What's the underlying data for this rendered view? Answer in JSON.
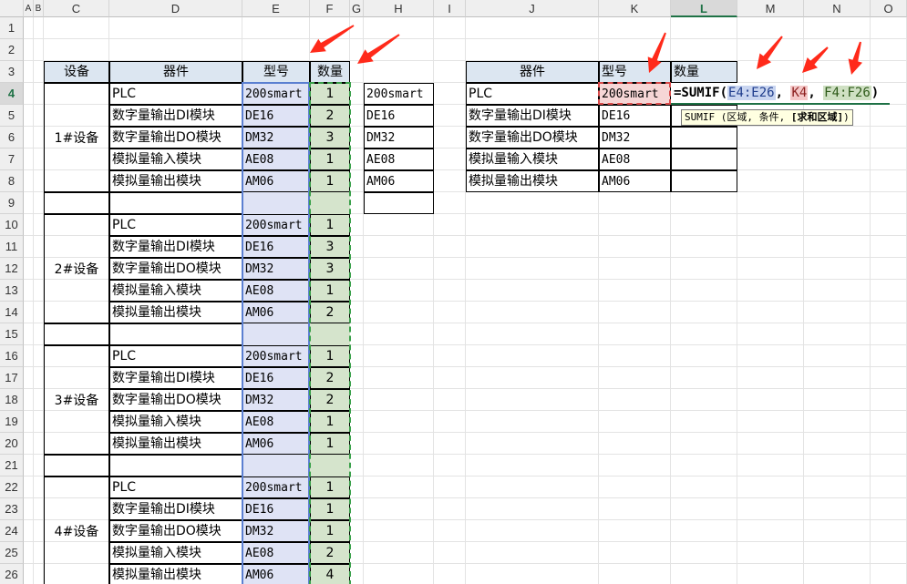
{
  "columns": [
    "A",
    "B",
    "C",
    "D",
    "E",
    "F",
    "G",
    "H",
    "I",
    "J",
    "K",
    "L",
    "M",
    "N",
    "O"
  ],
  "rows": [
    "1",
    "2",
    "3",
    "4",
    "5",
    "6",
    "7",
    "8",
    "9",
    "10",
    "11",
    "12",
    "13",
    "14",
    "15",
    "16",
    "17",
    "18",
    "19",
    "20",
    "21",
    "22",
    "23",
    "24",
    "25",
    "26"
  ],
  "selected_column": "L",
  "selected_row": "4",
  "left_table": {
    "headers": {
      "device": "设备",
      "component": "器件",
      "model": "型号",
      "qty": "数量"
    },
    "groups": [
      {
        "device": "1#设备",
        "items": [
          {
            "component": "PLC",
            "model": "200smart",
            "qty": "1"
          },
          {
            "component": "数字量输出DI模块",
            "model": "DE16",
            "qty": "2"
          },
          {
            "component": "数字量输出DO模块",
            "model": "DM32",
            "qty": "3"
          },
          {
            "component": "模拟量输入模块",
            "model": "AE08",
            "qty": "1"
          },
          {
            "component": "模拟量输出模块",
            "model": "AM06",
            "qty": "1"
          }
        ]
      },
      {
        "device": "2#设备",
        "items": [
          {
            "component": "PLC",
            "model": "200smart",
            "qty": "1"
          },
          {
            "component": "数字量输出DI模块",
            "model": "DE16",
            "qty": "3"
          },
          {
            "component": "数字量输出DO模块",
            "model": "DM32",
            "qty": "3"
          },
          {
            "component": "模拟量输入模块",
            "model": "AE08",
            "qty": "1"
          },
          {
            "component": "模拟量输出模块",
            "model": "AM06",
            "qty": "2"
          }
        ]
      },
      {
        "device": "3#设备",
        "items": [
          {
            "component": "PLC",
            "model": "200smart",
            "qty": "1"
          },
          {
            "component": "数字量输出DI模块",
            "model": "DE16",
            "qty": "2"
          },
          {
            "component": "数字量输出DO模块",
            "model": "DM32",
            "qty": "2"
          },
          {
            "component": "模拟量输入模块",
            "model": "AE08",
            "qty": "1"
          },
          {
            "component": "模拟量输出模块",
            "model": "AM06",
            "qty": "1"
          }
        ]
      },
      {
        "device": "4#设备",
        "items": [
          {
            "component": "PLC",
            "model": "200smart",
            "qty": "1"
          },
          {
            "component": "数字量输出DI模块",
            "model": "DE16",
            "qty": "1"
          },
          {
            "component": "数字量输出DO模块",
            "model": "DM32",
            "qty": "1"
          },
          {
            "component": "模拟量输入模块",
            "model": "AE08",
            "qty": "2"
          },
          {
            "component": "模拟量输出模块",
            "model": "AM06",
            "qty": "4"
          }
        ]
      }
    ]
  },
  "h_list": [
    "200smart",
    "DE16",
    "DM32",
    "AE08",
    "AM06",
    ""
  ],
  "right_table": {
    "headers": {
      "component": "器件",
      "model": "型号",
      "qty": "数量"
    },
    "rows": [
      {
        "component": "PLC",
        "model": "200smart"
      },
      {
        "component": "数字量输出DI模块",
        "model": "DE16"
      },
      {
        "component": "数字量输出DO模块",
        "model": "DM32"
      },
      {
        "component": "模拟量输入模块",
        "model": "AE08"
      },
      {
        "component": "模拟量输出模块",
        "model": "AM06"
      }
    ]
  },
  "formula": {
    "prefix": "=SUMIF(",
    "arg1": "E4:E26",
    "sep1": ", ",
    "arg2": "K4",
    "sep2": ", ",
    "arg3": "F4:F26",
    "suffix": ")"
  },
  "tooltip": {
    "text": "SUMIF (区域, 条件, ",
    "bold": "[求和区域]",
    "close": ")"
  },
  "colors": {
    "header_fill": "#dce6f1",
    "model_range_fill": "#dfe3f5",
    "qty_range_fill": "#d5e4cc",
    "criteria_fill": "#f6d6d6",
    "arrow": "#ff2a1a"
  }
}
